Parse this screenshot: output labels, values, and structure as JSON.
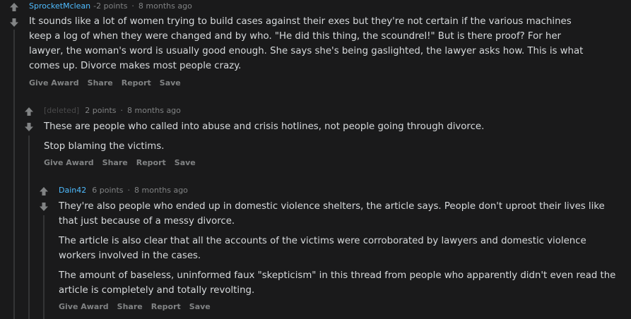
{
  "colors": {
    "background": "#1a1a1b",
    "text": "#d7dadc",
    "meta": "#818384",
    "author": "#4fbcff",
    "thread_line": "#343536"
  },
  "comments": [
    {
      "author": "SprocketMclean",
      "score": "-2 points",
      "time": "8 months ago",
      "paragraphs": [
        "It sounds like a lot of women trying to build cases against their exes but they're not certain if the various machines keep a log of when they were changed and by who. \"He did this thing, the scoundrel!\" But is there proof? For her lawyer, the woman's word is usually good enough. She says she's being gaslighted, the lawyer asks how. This is what comes up. Divorce makes most people crazy."
      ],
      "actions": [
        "Give Award",
        "Share",
        "Report",
        "Save"
      ]
    },
    {
      "author": "[deleted]",
      "score": "2 points",
      "time": "8 months ago",
      "paragraphs": [
        "These are people who called into abuse and crisis hotlines, not people going through divorce.",
        "Stop blaming the victims."
      ],
      "actions": [
        "Give Award",
        "Share",
        "Report",
        "Save"
      ]
    },
    {
      "author": "Dain42",
      "score": "6 points",
      "time": "8 months ago",
      "paragraphs": [
        "They're also people who ended up in domestic violence shelters, the article says. People don't uproot their lives like that just because of a messy divorce.",
        "The article is also clear that all the accounts of the victims were corroborated by lawyers and domestic violence workers involved in the cases.",
        "The amount of baseless, uninformed faux \"skepticism\" in this thread from people who apparently didn't even read the article is completely and totally revolting."
      ],
      "actions": [
        "Give Award",
        "Share",
        "Report",
        "Save"
      ]
    }
  ]
}
